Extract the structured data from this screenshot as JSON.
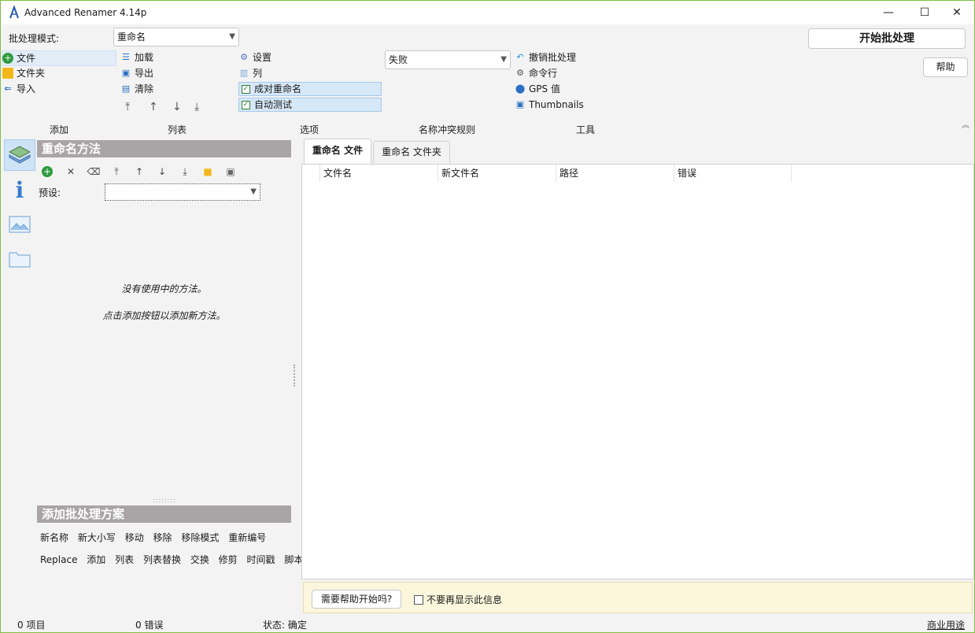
{
  "window": {
    "title": "Advanced Renamer 4.14p"
  },
  "controls": {
    "minimize": "—",
    "maximize": "☐",
    "close": "✕"
  },
  "batch_mode": {
    "label": "批处理模式:",
    "value": "重命名"
  },
  "start_button": "开始批处理",
  "help_button": "帮助",
  "add_menu": {
    "files": "文件",
    "folders": "文件夹",
    "import": "导入"
  },
  "list_menu": {
    "load": "加载",
    "export": "导出",
    "clear": "清除"
  },
  "options_menu": {
    "settings": "设置",
    "columns": "列",
    "pair_rename": "成对重命名",
    "auto_test": "自动测试"
  },
  "conflict": {
    "value": "失败"
  },
  "tools_menu": {
    "undo": "撤销批处理",
    "cmd": "命令行",
    "gps": "GPS 值",
    "thumbnails": "Thumbnails"
  },
  "sections": {
    "add": "添加",
    "list": "列表",
    "options": "选项",
    "conflict": "名称冲突规则",
    "tools": "工具"
  },
  "methods_panel": {
    "title": "重命名方法",
    "preset_label": "预设:",
    "preset_value": "",
    "empty_line1": "没有使用中的方法。",
    "empty_line2": "点击添加按钮以添加新方法。"
  },
  "add_methods": {
    "title": "添加批处理方案",
    "row1": [
      "新名称",
      "新大小写",
      "移动",
      "移除",
      "移除模式",
      "重新编号"
    ],
    "row2": [
      "Replace",
      "添加",
      "列表",
      "列表替换",
      "交换",
      "修剪",
      "时间戳",
      "脚本"
    ]
  },
  "tabs": {
    "rename_files": "重命名 文件",
    "rename_folders": "重命名 文件夹"
  },
  "columns": {
    "filename": "文件名",
    "new_filename": "新文件名",
    "path": "路径",
    "error": "错误"
  },
  "help_bar": {
    "button": "需要帮助开始吗?",
    "checkbox": "不要再显示此信息"
  },
  "statusbar": {
    "items": "0 项目",
    "errors": "0 错误",
    "state": "状态: 确定",
    "commercial": "商业用途"
  },
  "colors": {
    "accent_green": "#7fbf3f",
    "panel_head": "#a9a4a5",
    "help_bg": "#fbf6dc",
    "link_blue": "#1a5fb4"
  }
}
